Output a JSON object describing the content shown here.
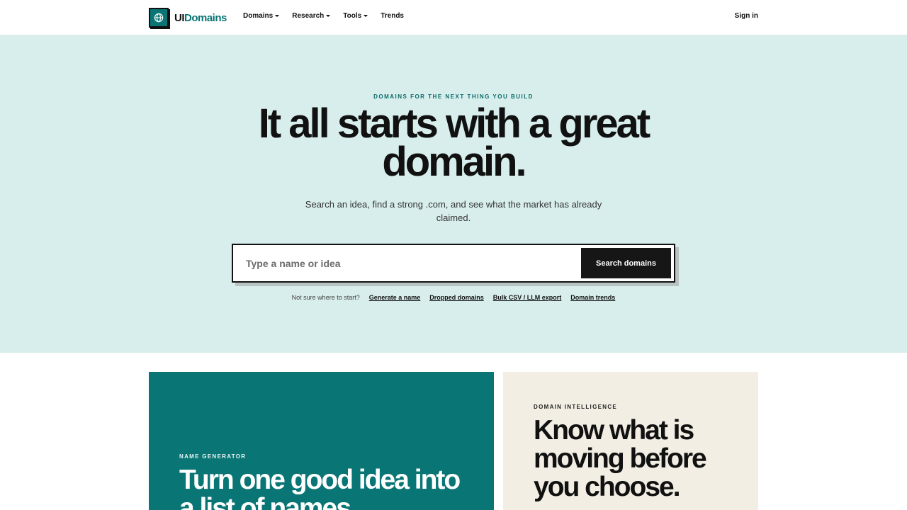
{
  "brand": {
    "name_part1": "UI",
    "name_part2": "Domains",
    "icon": "globe-icon"
  },
  "nav": {
    "items": [
      {
        "label": "Domains",
        "has_dropdown": true
      },
      {
        "label": "Research",
        "has_dropdown": true
      },
      {
        "label": "Tools",
        "has_dropdown": true
      },
      {
        "label": "Trends",
        "has_dropdown": false
      }
    ],
    "sign_in": "Sign in"
  },
  "hero": {
    "eyebrow": "DOMAINS FOR THE NEXT THING YOU BUILD",
    "headline": "It all starts with a great domain.",
    "subheadline": "Search an idea, find a strong .com, and see what the market has already claimed.",
    "search": {
      "placeholder": "Type a name or idea",
      "value": "",
      "button_label": "Search domains"
    },
    "quick_links": {
      "lead": "Not sure where to start?",
      "links": [
        "Generate a name",
        "Dropped domains",
        "Bulk CSV / LLM export",
        "Domain trends"
      ]
    }
  },
  "cards": {
    "name_generator": {
      "label": "NAME GENERATOR",
      "title": "Turn one good idea into a list of names."
    },
    "domain_intelligence": {
      "label": "DOMAIN INTELLIGENCE",
      "title": "Know what is moving before you choose."
    }
  },
  "colors": {
    "brand_teal": "#0a7575",
    "hero_bg": "#d8eeec",
    "intel_bg": "#f2eee4",
    "button_dark": "#161616"
  }
}
